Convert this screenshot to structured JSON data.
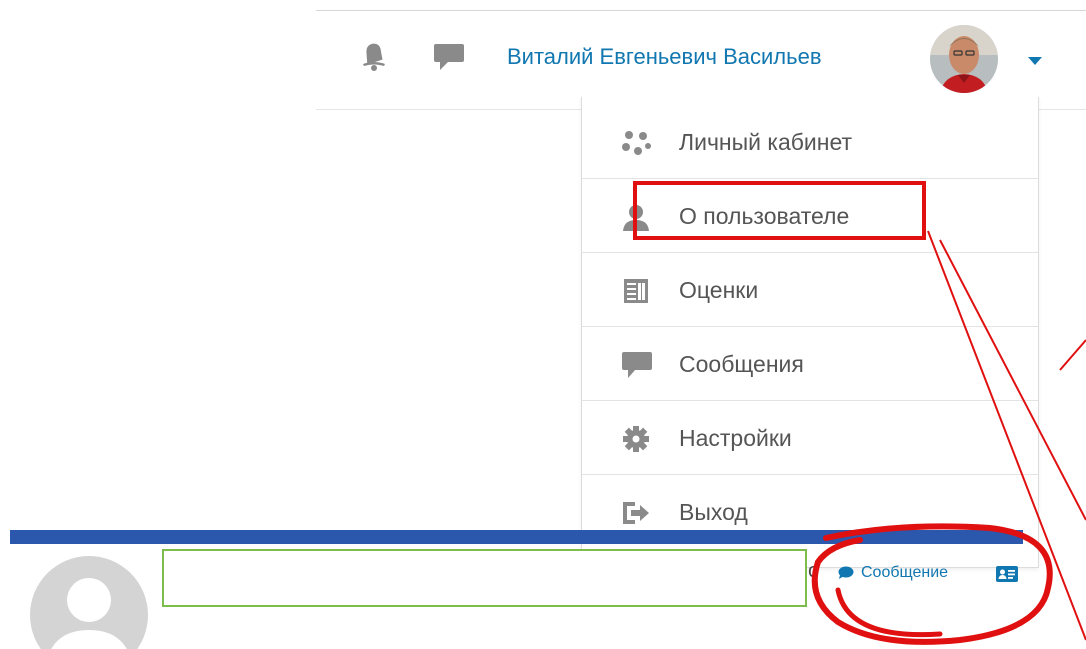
{
  "header": {
    "user_name": "Виталий Евгеньевич Васильев"
  },
  "user_menu": {
    "items": [
      {
        "label": "Личный кабинет",
        "icon": "dashboard-icon"
      },
      {
        "label": "О пользователе",
        "icon": "user-icon"
      },
      {
        "label": "Оценки",
        "icon": "grades-table-icon"
      },
      {
        "label": "Сообщения",
        "icon": "message-bubble-icon"
      },
      {
        "label": "Настройки",
        "icon": "gear-icon"
      },
      {
        "label": "Выход",
        "icon": "logout-icon"
      }
    ]
  },
  "profile": {
    "message_link": "Сообщение",
    "partial_text": "о"
  },
  "colors": {
    "link": "#1177b0",
    "bar": "#2b57ad",
    "annotation": "#e01010",
    "green_box": "#7dbd4d"
  }
}
